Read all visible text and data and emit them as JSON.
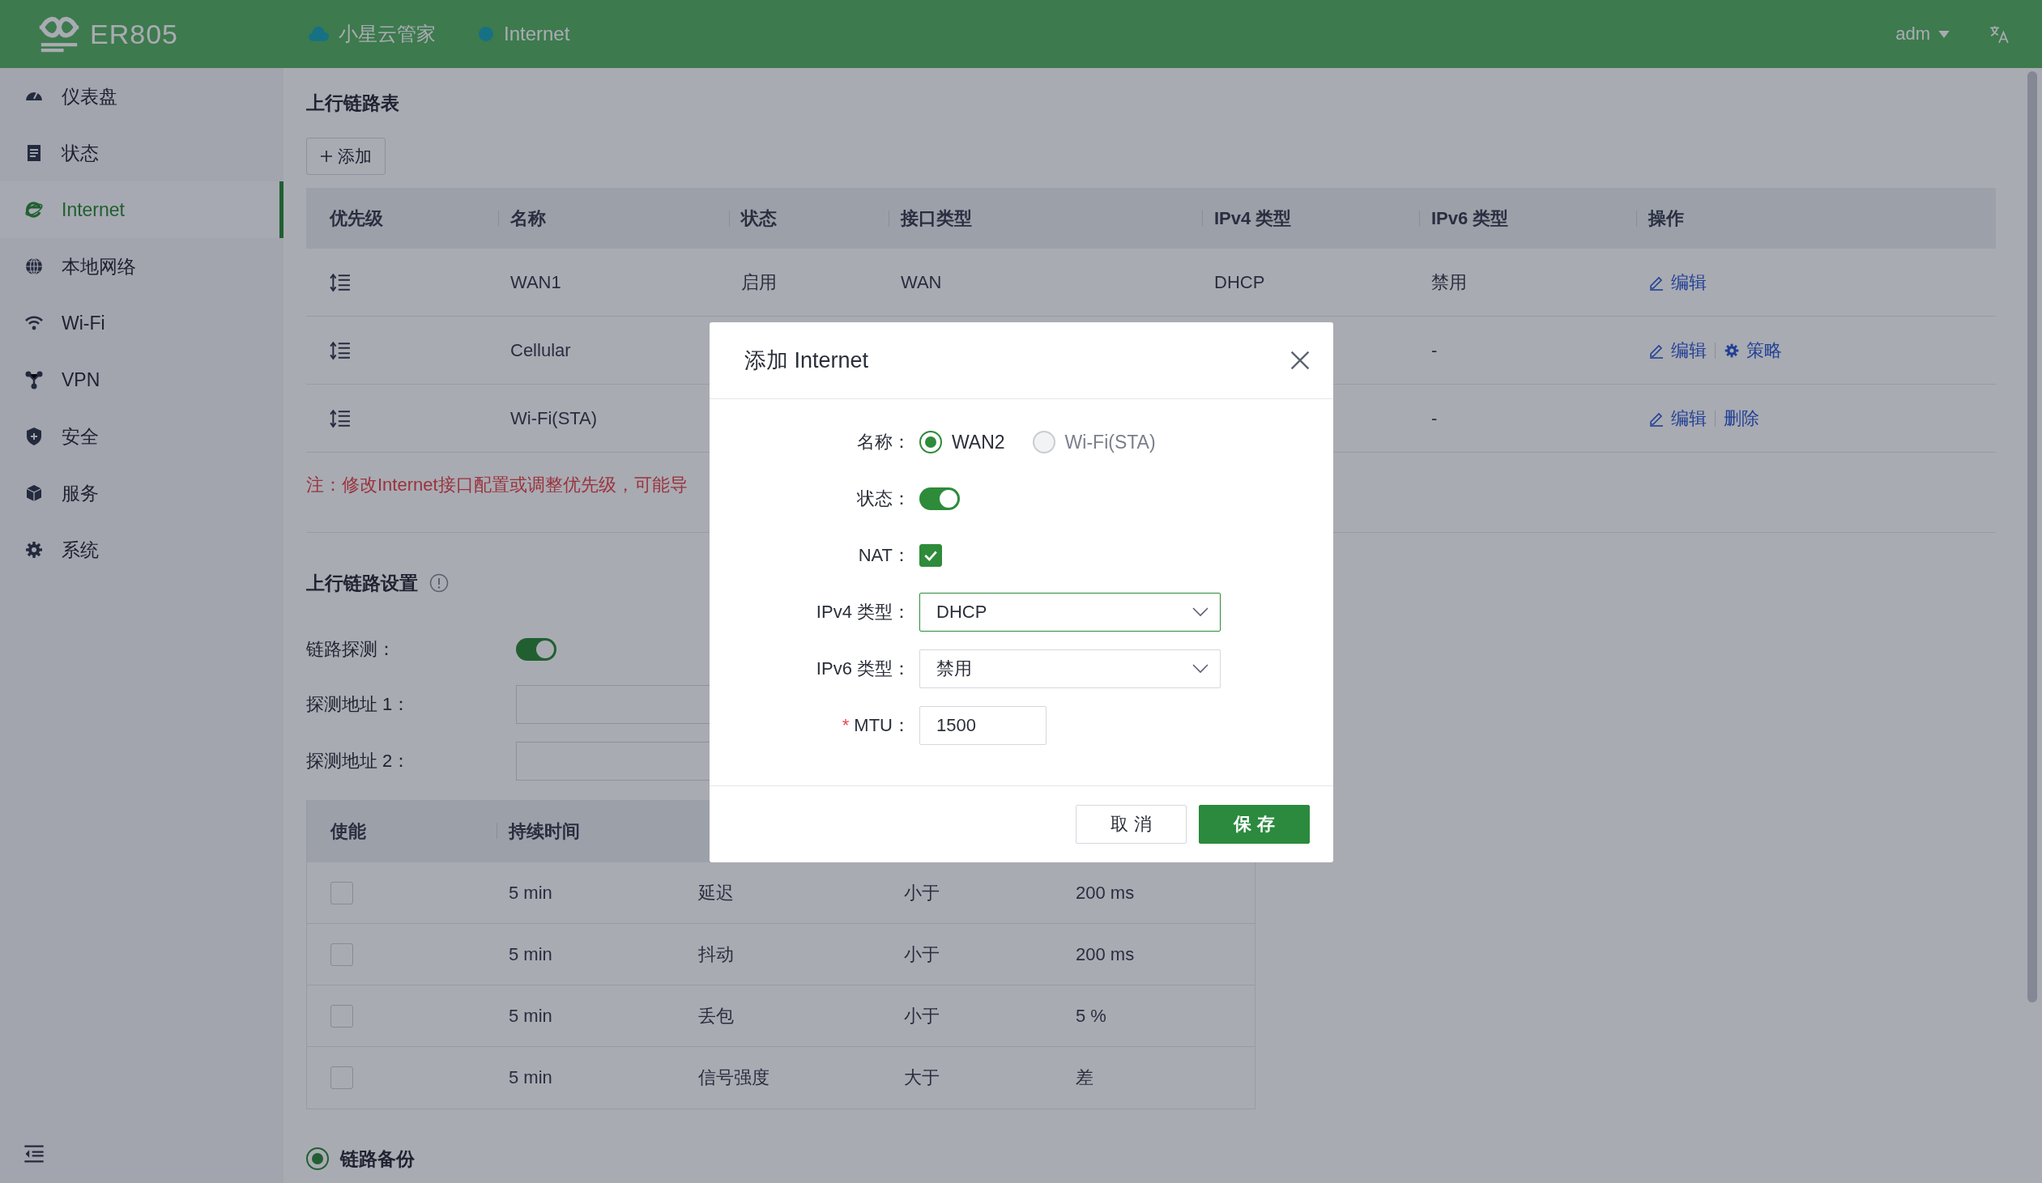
{
  "header": {
    "brand": "ER805",
    "links": [
      {
        "kind": "cloud",
        "label": "小星云管家"
      },
      {
        "kind": "dot",
        "label": "Internet"
      }
    ],
    "user": "adm"
  },
  "sidebar": {
    "items": [
      {
        "kind": "gauge",
        "label": "仪表盘",
        "selected": false
      },
      {
        "kind": "document",
        "label": "状态",
        "selected": false
      },
      {
        "kind": "browser",
        "label": "Internet",
        "selected": true
      },
      {
        "kind": "globe",
        "label": "本地网络",
        "selected": false
      },
      {
        "kind": "wifi",
        "label": "Wi-Fi",
        "selected": false
      },
      {
        "kind": "nodes",
        "label": "VPN",
        "selected": false
      },
      {
        "kind": "shield",
        "label": "安全",
        "selected": false
      },
      {
        "kind": "cube",
        "label": "服务",
        "selected": false
      },
      {
        "kind": "gear",
        "label": "系统",
        "selected": false
      }
    ]
  },
  "uplink_table": {
    "title": "上行链路表",
    "add_button": "添加",
    "columns": [
      "优先级",
      "名称",
      "状态",
      "接口类型",
      "IPv4 类型",
      "IPv6 类型",
      "操作"
    ],
    "rows": [
      {
        "name": "WAN1",
        "status": "启用",
        "interface": "WAN",
        "ipv4": "DHCP",
        "ipv6": "禁用",
        "actions": [
          {
            "kind": "edit",
            "label": "编辑"
          }
        ]
      },
      {
        "name": "Cellular",
        "ipv6": "-",
        "actions": [
          {
            "kind": "edit",
            "label": "编辑"
          },
          {
            "kind": "policy",
            "label": "策略"
          }
        ]
      },
      {
        "name": "Wi-Fi(STA)",
        "ipv6": "-",
        "actions": [
          {
            "kind": "edit",
            "label": "编辑"
          },
          {
            "kind": "delete",
            "label": "删除"
          }
        ]
      }
    ]
  },
  "note": "注：修改Internet接口配置或调整优先级，可能导",
  "uplink_settings": {
    "title": "上行链路设置",
    "probe": {
      "label": "链路探测：",
      "on": true
    },
    "addresses": [
      {
        "label": "探测地址 1："
      },
      {
        "label": "探测地址 2："
      }
    ],
    "table": {
      "columns": [
        "使能",
        "持续时间"
      ],
      "rows": [
        {
          "enabled": false,
          "duration": "5 min",
          "metric": "延迟",
          "compare": "小于",
          "threshold": "200 ms"
        },
        {
          "enabled": false,
          "duration": "5 min",
          "metric": "抖动",
          "compare": "小于",
          "threshold": "200 ms"
        },
        {
          "enabled": false,
          "duration": "5 min",
          "metric": "丢包",
          "compare": "小于",
          "threshold": "5 %"
        },
        {
          "enabled": false,
          "duration": "5 min",
          "metric": "信号强度",
          "compare": "大于",
          "threshold": "差"
        }
      ]
    },
    "backup": {
      "label": "链路备份",
      "selected": true
    }
  },
  "dialog": {
    "title": "添加 Internet",
    "fields": [
      {
        "kind": "radio",
        "label": "名称：",
        "options": [
          {
            "label": "WAN2",
            "selected": true
          },
          {
            "label": "Wi-Fi(STA)",
            "selected": false
          }
        ]
      },
      {
        "kind": "toggle",
        "label": "状态：",
        "on": true
      },
      {
        "kind": "checkbox",
        "label": "NAT：",
        "checked": true
      },
      {
        "kind": "select",
        "label": "IPv4 类型：",
        "value": "DHCP",
        "focused": true
      },
      {
        "kind": "select",
        "label": "IPv6 类型：",
        "value": "禁用",
        "focused": false
      },
      {
        "kind": "input",
        "label": "MTU：",
        "required_mark": "*",
        "value": "1500"
      }
    ],
    "buttons": [
      {
        "kind": "default",
        "label": "取 消"
      },
      {
        "kind": "primary",
        "label": "保 存"
      }
    ]
  }
}
